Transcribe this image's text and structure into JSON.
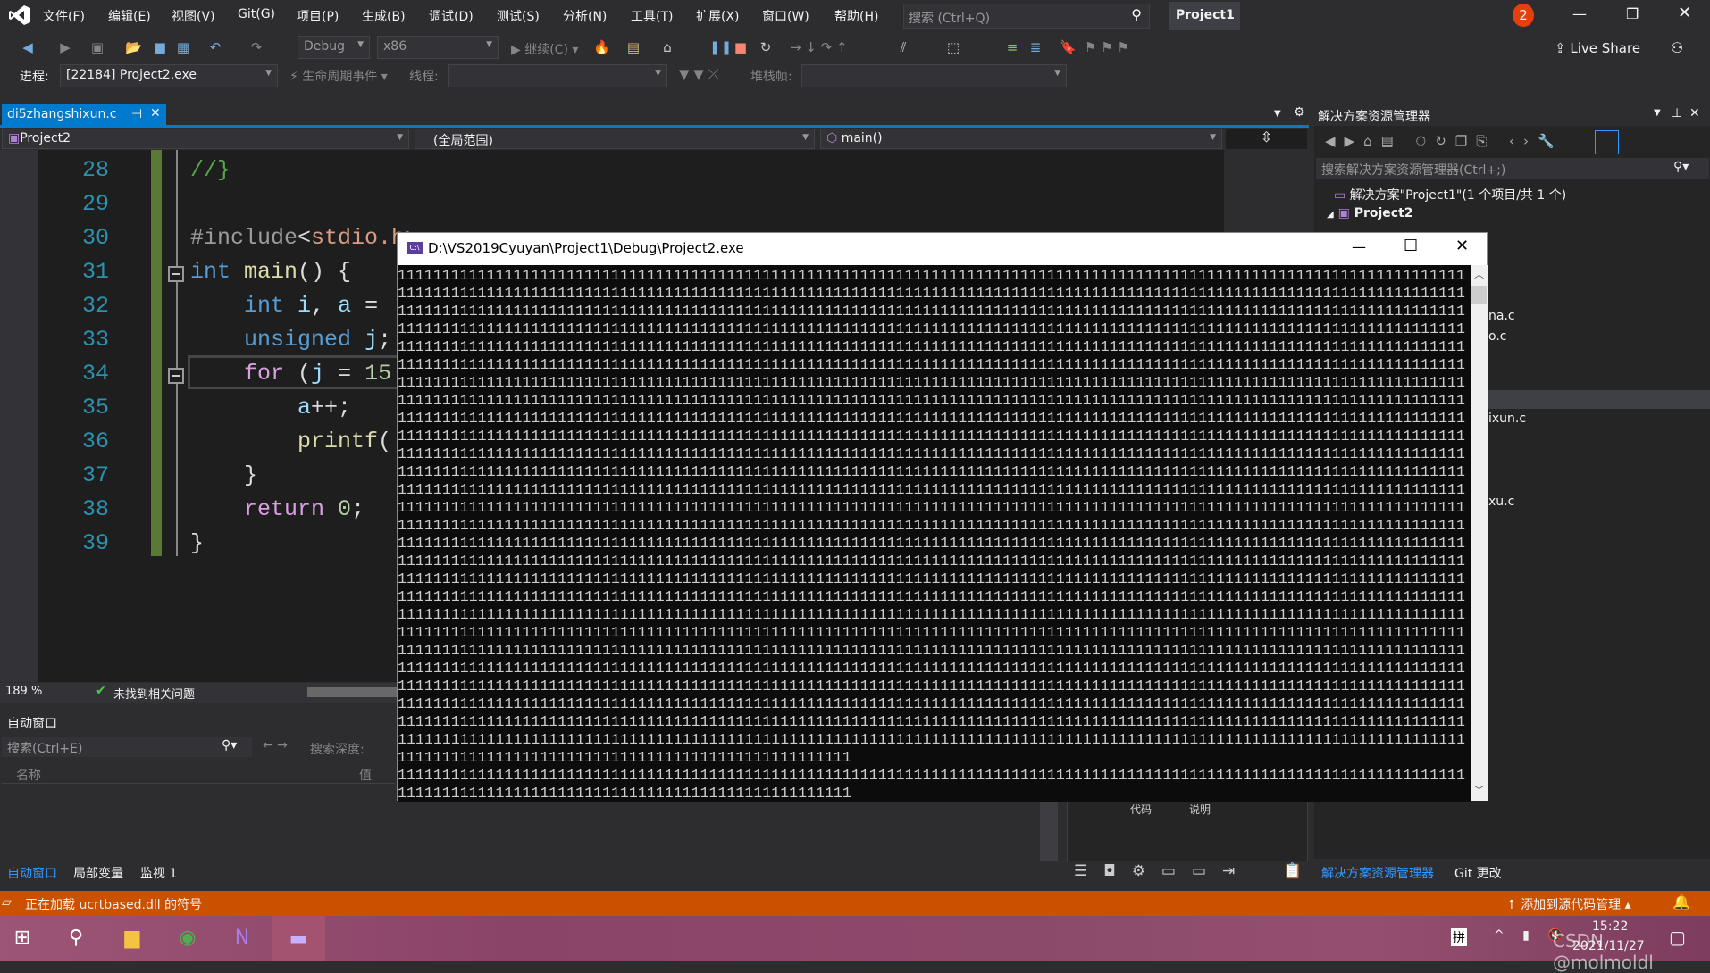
{
  "menu": {
    "items": [
      "文件(F)",
      "编辑(E)",
      "视图(V)",
      "Git(G)",
      "项目(P)",
      "生成(B)",
      "调试(D)",
      "测试(S)",
      "分析(N)",
      "工具(T)",
      "扩展(X)",
      "窗口(W)",
      "帮助(H)"
    ],
    "search_placeholder": "搜索 (Ctrl+Q)",
    "solution_name": "Project1",
    "notification_count": "2"
  },
  "toolbar": {
    "config": "Debug",
    "platform": "x86",
    "continue_label": "继续(C)",
    "live_share": "Live Share"
  },
  "debug_bar": {
    "process_label": "进程:",
    "process_value": "[22184] Project2.exe",
    "lifecycle_label": "生命周期事件",
    "thread_label": "线程:",
    "stack_label": "堆栈帧:"
  },
  "editor": {
    "tab_name": "di5zhangshixun.c",
    "nav_project": "Project2",
    "nav_scope": "(全局范围)",
    "nav_member": "main()",
    "lines": [
      {
        "n": "28",
        "t": "//}"
      },
      {
        "n": "29",
        "t": ""
      },
      {
        "n": "30",
        "t": "#include<stdio.h>"
      },
      {
        "n": "31",
        "t": "int main() {"
      },
      {
        "n": "32",
        "t": "    int i, a ="
      },
      {
        "n": "33",
        "t": "    unsigned j;"
      },
      {
        "n": "34",
        "t": "    for (j = 15"
      },
      {
        "n": "35",
        "t": "        a++;"
      },
      {
        "n": "36",
        "t": "        printf("
      },
      {
        "n": "37",
        "t": "    }"
      },
      {
        "n": "38",
        "t": "    return 0;"
      },
      {
        "n": "39",
        "t": "}"
      }
    ],
    "zoom": "189 %",
    "issues": "未找到相关问题"
  },
  "auto_window": {
    "title": "自动窗口",
    "search_placeholder": "搜索(Ctrl+E)",
    "depth_label": "搜索深度:",
    "col_name": "名称",
    "col_value": "值",
    "tabs": [
      "自动窗口",
      "局部变量",
      "监视 1"
    ]
  },
  "error_list": {
    "col_code": "代码",
    "col_desc": "说明"
  },
  "solution_explorer": {
    "title": "解决方案资源管理器",
    "search_placeholder": "搜索解决方案资源管理器(Ctrl+;)",
    "solution_row": "解决方案\"Project1\"(1 个项目/共 1 个)",
    "project_row": "Project2",
    "partial_items": [
      "na.c",
      "o.c",
      "ixun.c",
      "xu.c"
    ],
    "tabs": [
      "解决方案资源管理器",
      "Git 更改"
    ]
  },
  "console": {
    "title": "D:\\VS2019Cyuyan\\Project1\\Debug\\Project2.exe",
    "lines": [
      "111111111111111111111111111111111111111111111111111111111111111111111111111111111111111111111111111111111111111111111111",
      "111111111111111111111111111111111111111111111111111111111111111111111111111111111111111111111111111111111111111111111111",
      "111111111111111111111111111111111111111111111111111111111111111111111111111111111111111111111111111111111111111111111111",
      "111111111111111111111111111111111111111111111111111111111111111111111111111111111111111111111111111111111111111111111111",
      "111111111111111111111111111111111111111111111111111111111111111111111111111111111111111111111111111111111111111111111111",
      "111111111111111111111111111111111111111111111111111111111111111111111111111111111111111111111111111111111111111111111111",
      "111111111111111111111111111111111111111111111111111111111111111111111111111111111111111111111111111111111111111111111111",
      "111111111111111111111111111111111111111111111111111111111111111111111111111111111111111111111111111111111111111111111111",
      "111111111111111111111111111111111111111111111111111111111111111111111111111111111111111111111111111111111111111111111111",
      "111111111111111111111111111111111111111111111111111111111111111111111111111111111111111111111111111111111111111111111111",
      "111111111111111111111111111111111111111111111111111111111111111111111111111111111111111111111111111111111111111111111111",
      "111111111111111111111111111111111111111111111111111111111111111111111111111111111111111111111111111111111111111111111111",
      "111111111111111111111111111111111111111111111111111111111111111111111111111111111111111111111111111111111111111111111111",
      "111111111111111111111111111111111111111111111111111111111111111111111111111111111111111111111111111111111111111111111111",
      "111111111111111111111111111111111111111111111111111111111111111111111111111111111111111111111111111111111111111111111111",
      "111111111111111111111111111111111111111111111111111111111111111111111111111111111111111111111111111111111111111111111111",
      "111111111111111111111111111111111111111111111111111111111111111111111111111111111111111111111111111111111111111111111111",
      "111111111111111111111111111111111111111111111111111111111111111111111111111111111111111111111111111111111111111111111111",
      "111111111111111111111111111111111111111111111111111111111111111111111111111111111111111111111111111111111111111111111111",
      "111111111111111111111111111111111111111111111111111111111111111111111111111111111111111111111111111111111111111111111111",
      "111111111111111111111111111111111111111111111111111111111111111111111111111111111111111111111111111111111111111111111111",
      "111111111111111111111111111111111111111111111111111111111111111111111111111111111111111111111111111111111111111111111111",
      "111111111111111111111111111111111111111111111111111111111111111111111111111111111111111111111111111111111111111111111111",
      "111111111111111111111111111111111111111111111111111111111111111111111111111111111111111111111111111111111111111111111111",
      "111111111111111111111111111111111111111111111111111111111111111111111111111111111111111111111111111111111111111111111111",
      "111111111111111111111111111111111111111111111111111111111111111111111111111111111111111111111111111111111111111111111111",
      "111111111111111111111111111111111111111111111111111111111111111111111111111111111111111111111111111111111111111111111111",
      "111111111111111111111111111111111111111111111111111",
      "111111111111111111111111111111111111111111111111111111111111111111111111111111111111111111111111111111111111111111111111",
      "111111111111111111111111111111111111111111111111111"
    ]
  },
  "status_bar": {
    "message": "正在加载 ucrtbased.dll 的符号",
    "source_control": "添加到源代码管理",
    "color": "#ca5100"
  },
  "taskbar": {
    "ime": "拼",
    "time": "15:22",
    "date": "2021/11/27",
    "watermark": "CSDN @molmoldl"
  },
  "colors": {
    "accent": "#007acc",
    "keyword": "#569cd6",
    "line_number": "#2b91af"
  }
}
